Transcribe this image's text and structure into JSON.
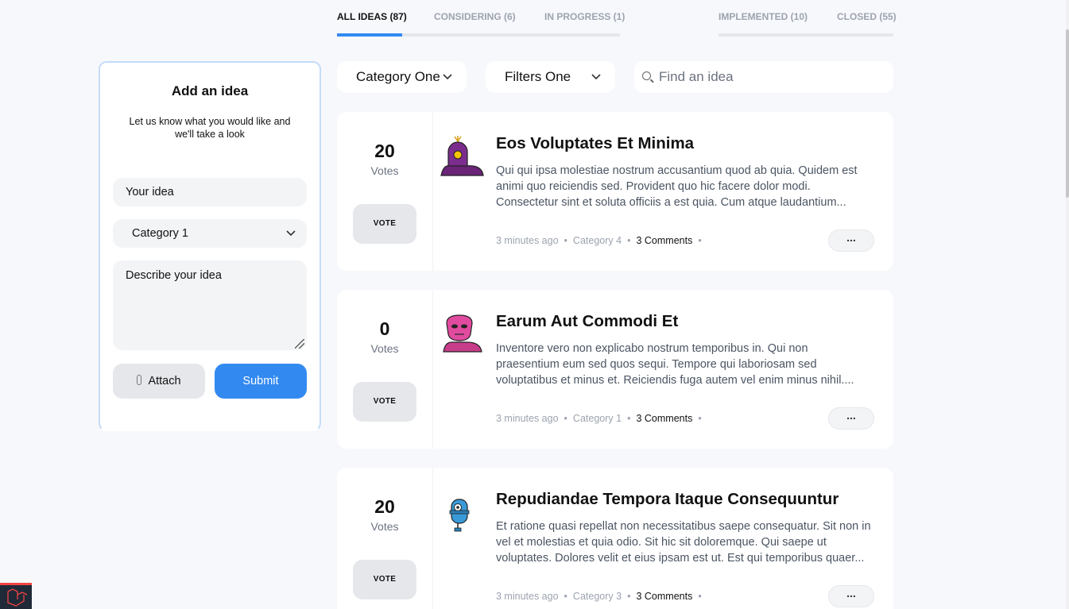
{
  "tabs": [
    {
      "label": "ALL IDEAS (87)"
    },
    {
      "label": "CONSIDERING (6)"
    },
    {
      "label": "IN PROGRESS (1)"
    },
    {
      "label": "IMPLEMENTED (10)"
    },
    {
      "label": "CLOSED (55)"
    }
  ],
  "add_idea": {
    "title": "Add an idea",
    "subtitle": "Let us know what you would like and we'll take a look",
    "idea_placeholder": "Your idea",
    "category_value": "Category 1",
    "description_placeholder": "Describe your idea",
    "attach_label": "Attach",
    "submit_label": "Submit"
  },
  "filters": {
    "category": "Category One",
    "filter": "Filters One",
    "search_placeholder": "Find an idea"
  },
  "ideas": [
    {
      "votes": "20",
      "votes_label": "Votes",
      "vote_button": "VOTE",
      "title": "Eos Voluptates Et Minima",
      "body": "Qui qui ipsa molestiae nostrum accusantium quod ab quia. Quidem est animi quo reiciendis sed. Provident quo hic facere dolor modi. Consectetur sint et soluta officiis a est quia. Cum atque laudantium...",
      "time": "3 minutes ago",
      "category": "Category 4",
      "comments": "3 Comments",
      "more": "...",
      "avatar_color": "#7b2d8e"
    },
    {
      "votes": "0",
      "votes_label": "Votes",
      "vote_button": "VOTE",
      "title": "Earum Aut Commodi Et",
      "body": "Inventore vero non explicabo nostrum temporibus in. Qui non praesentium eum sed quos sequi. Tempore qui laboriosam sed voluptatibus et minus et. Reiciendis fuga autem vel enim minus nihil....",
      "time": "3 minutes ago",
      "category": "Category 1",
      "comments": "3 Comments",
      "more": "...",
      "avatar_color": "#e04b9f"
    },
    {
      "votes": "20",
      "votes_label": "Votes",
      "vote_button": "VOTE",
      "title": "Repudiandae Tempora Itaque Consequuntur",
      "body": "Et ratione quasi repellat non necessitatibus saepe consequatur. Sit non in vel et molestias et quia odio. Sit hic sit doloremque. Qui saepe ut voluptates. Dolores velit et eius ipsam est ut. Est qui temporibus quaer...",
      "time": "3 minutes ago",
      "category": "Category 3",
      "comments": "3 Comments",
      "more": "...",
      "avatar_color": "#3a9ad9"
    }
  ],
  "colors": {
    "accent": "#328af1",
    "background": "#f7f8fc"
  }
}
